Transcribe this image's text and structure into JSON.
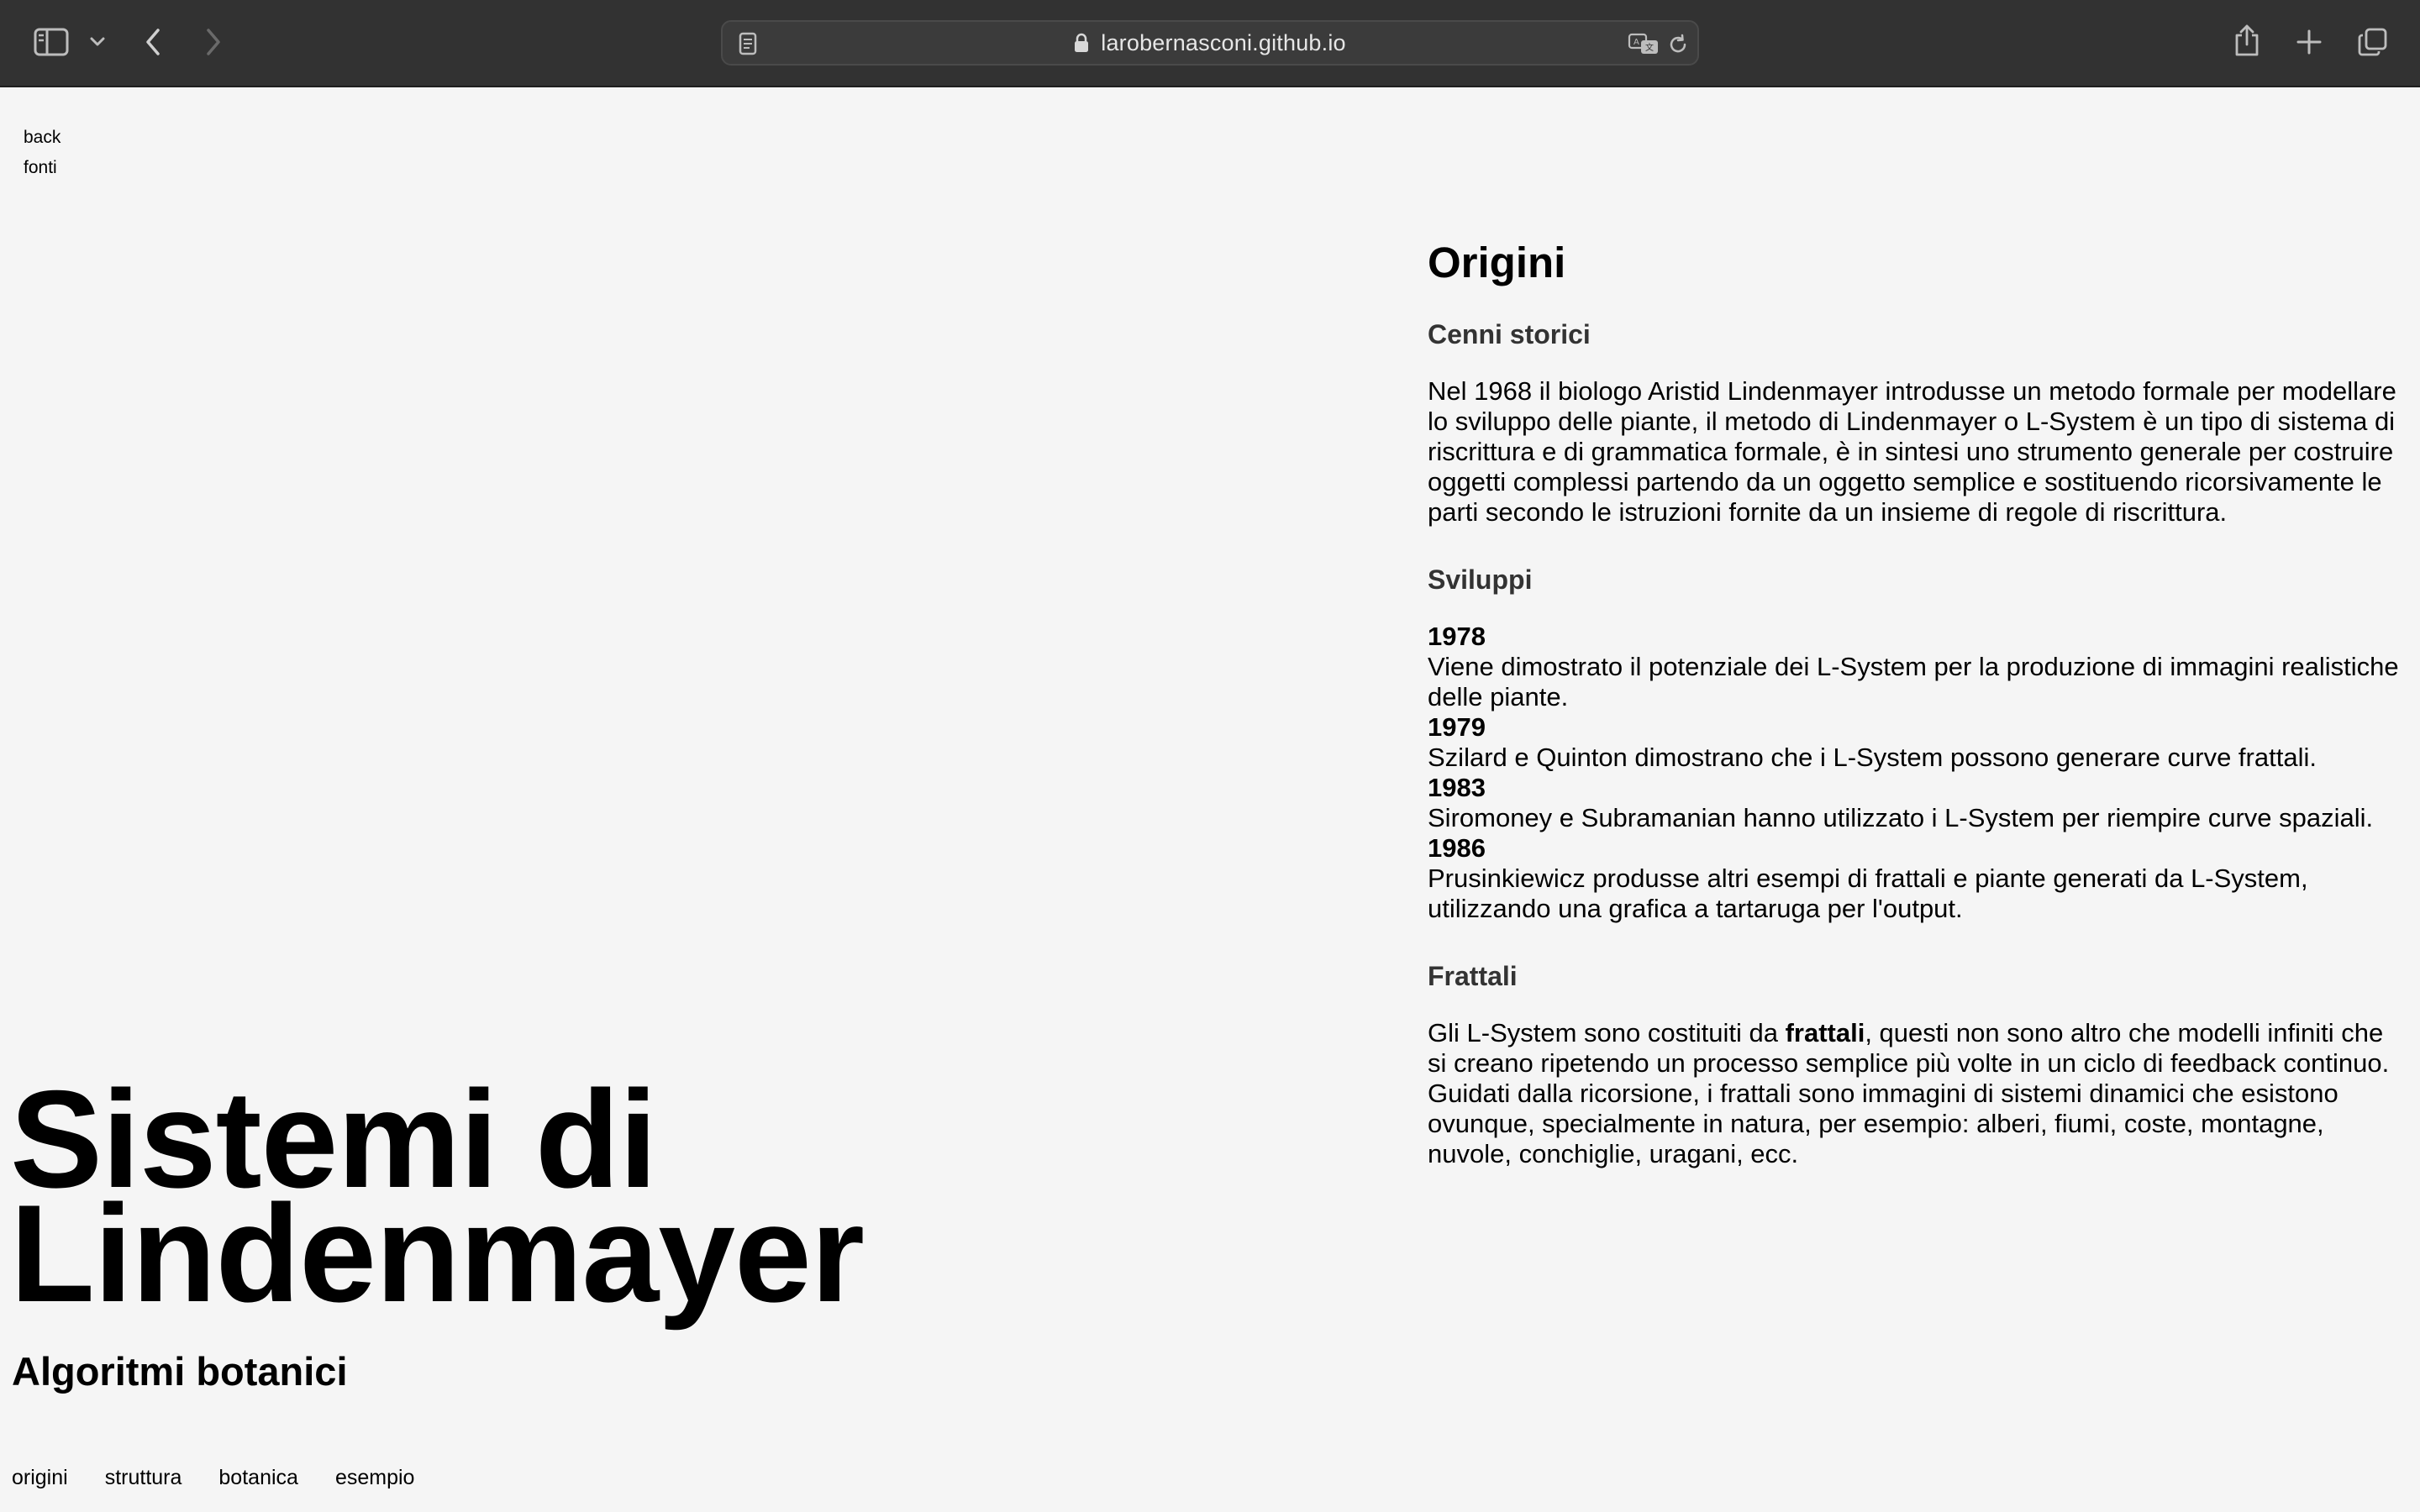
{
  "browser": {
    "url": "larobernasconi.github.io"
  },
  "topnav": {
    "back": "back",
    "fonti": "fonti"
  },
  "hero": {
    "title": "Sistemi di\nLindenmayer",
    "subtitle": "Algoritmi botanici"
  },
  "bottomnav": [
    "origini",
    "struttura",
    "botanica",
    "esempio"
  ],
  "content": {
    "heading": "Origini",
    "cenni": {
      "heading": "Cenni storici",
      "text": "Nel 1968 il biologo Aristid Lindenmayer introdusse un metodo formale per modellare lo sviluppo delle piante, il metodo di Lindenmayer o L-System è un tipo di sistema di riscrittura e di grammatica formale, è in sintesi uno strumento generale per costruire oggetti complessi partendo da un oggetto semplice e sostituendo ricorsivamente le parti secondo le istruzioni fornite da un insieme di regole di riscrittura."
    },
    "sviluppi": {
      "heading": "Sviluppi",
      "items": [
        {
          "year": "1978",
          "text": "Viene dimostrato il potenziale dei L-System per la produzione di immagini realistiche delle piante."
        },
        {
          "year": "1979",
          "text": "Szilard e Quinton dimostrano che i L-System possono generare curve frattali."
        },
        {
          "year": "1983",
          "text": "Siromoney e Subramanian hanno utilizzato i L-System per riempire curve spaziali."
        },
        {
          "year": "1986",
          "text": "Prusinkiewicz produsse altri esempi di frattali e piante generati da L-System, utilizzando una grafica a tartaruga per l'output."
        }
      ]
    },
    "frattali": {
      "heading": "Frattali",
      "text_before": "Gli L-System sono costituiti da ",
      "bold": "frattali",
      "text_after": ", questi non sono altro che modelli infiniti che si creano ripetendo un processo semplice più volte in un ciclo di feedback continuo. Guidati dalla ricorsione, i frattali sono immagini di sistemi dinamici che esistono ovunque, specialmente in natura, per esempio: alberi, fiumi, coste, montagne, nuvole, conchiglie, uragani, ecc."
    }
  }
}
